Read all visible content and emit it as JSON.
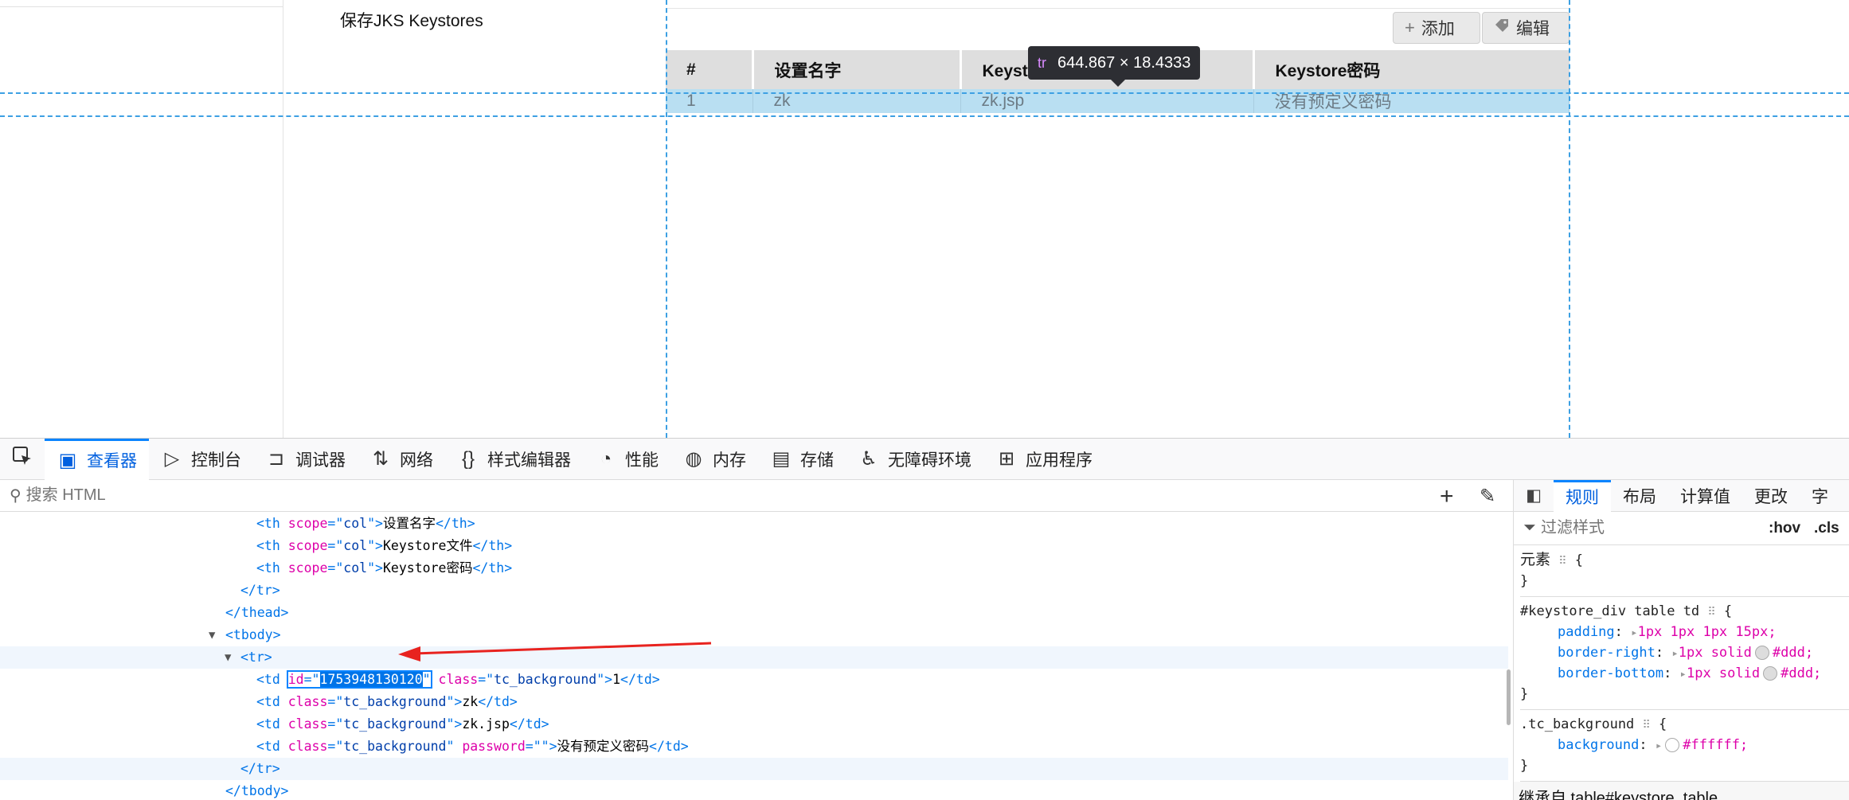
{
  "page": {
    "section_title": "保存JKS Keystores",
    "toolbar": {
      "add_label": "添加",
      "edit_label": "编辑"
    },
    "table": {
      "headers": [
        "#",
        "设置名字",
        "Keystore文件",
        "Keystore密码"
      ],
      "rows": [
        [
          "1",
          "zk",
          "zk.jsp",
          "没有预定义密码"
        ]
      ]
    },
    "tooltip": {
      "tag": "tr",
      "size": "644.867 × 18.4333"
    }
  },
  "devtools": {
    "tabs": [
      {
        "label": "查看器",
        "icon": "inspector-icon",
        "active": true
      },
      {
        "label": "控制台",
        "icon": "console-icon"
      },
      {
        "label": "调试器",
        "icon": "debugger-icon"
      },
      {
        "label": "网络",
        "icon": "network-icon"
      },
      {
        "label": "样式编辑器",
        "icon": "style-editor-icon"
      },
      {
        "label": "性能",
        "icon": "performance-icon"
      },
      {
        "label": "内存",
        "icon": "memory-icon"
      },
      {
        "label": "存储",
        "icon": "storage-icon"
      },
      {
        "label": "无障碍环境",
        "icon": "accessibility-icon"
      },
      {
        "label": "应用程序",
        "icon": "application-icon"
      }
    ],
    "search_placeholder": "搜索 HTML",
    "html": {
      "th1_text": "设置名字",
      "th2_text": "Keystore文件",
      "th3_text": "Keystore密码",
      "td_id": "1753948130120",
      "td1_text": "1",
      "td2_text": "zk",
      "td3_text": "zk.jsp",
      "td4_text": "没有预定义密码",
      "scope_val": "col",
      "class_val": "tc_background",
      "password_val": ""
    },
    "rules": {
      "tabs": [
        "规则",
        "布局",
        "计算值",
        "更改",
        "字"
      ],
      "filter_placeholder": "过滤样式",
      "hov": ":hov",
      "cls": ".cls",
      "element_selector": "元素",
      "rule1_selector": "#keystore_div table td",
      "rule1_props": [
        {
          "name": "padding",
          "value": "1px 1px 1px 15px;"
        },
        {
          "name": "border-right",
          "value": "1px solid",
          "color": "#ddd",
          "color_text": "#ddd;"
        },
        {
          "name": "border-bottom",
          "value": "1px solid",
          "color": "#ddd",
          "color_text": "#ddd;"
        }
      ],
      "rule2_selector": ".tc_background",
      "rule2_props": [
        {
          "name": "background",
          "color": "#ffffff",
          "color_text": "#ffffff;"
        }
      ],
      "inherited_label": "继承自 table#keystore_table"
    }
  },
  "colors": {
    "accent": "#0a84ff",
    "row_highlight": "#b9dff2",
    "guide": "#3da0e3",
    "arrow": "#e8231f"
  }
}
